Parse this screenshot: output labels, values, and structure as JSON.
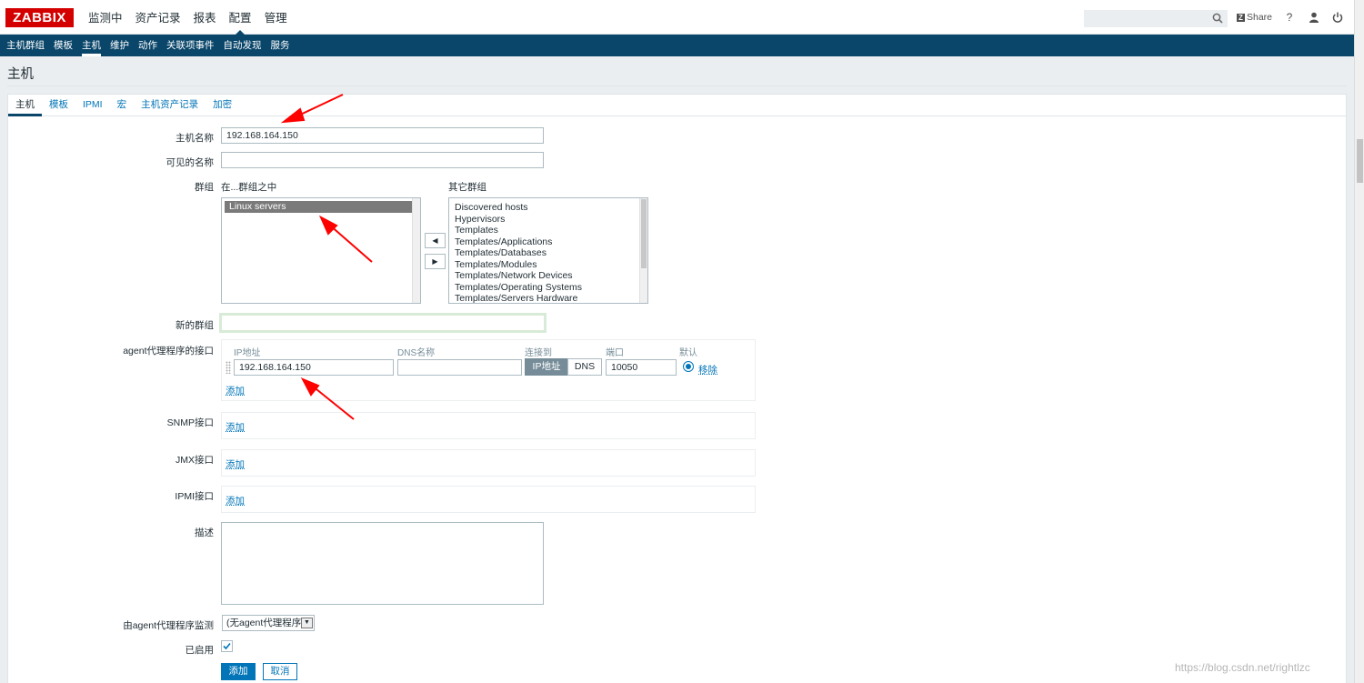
{
  "brand": {
    "logo": "ZABBIX"
  },
  "main_menu": [
    "监测中",
    "资产记录",
    "报表",
    "配置",
    "管理"
  ],
  "active_menu": "配置",
  "header_actions": {
    "share_label": "Share",
    "help": "?",
    "user": "user-icon",
    "logout": "power-icon"
  },
  "sub_nav": [
    "主机群组",
    "模板",
    "主机",
    "维护",
    "动作",
    "关联项事件",
    "自动发现",
    "服务"
  ],
  "page_title": "主机",
  "tabs": [
    "主机",
    "模板",
    "IPMI",
    "宏",
    "主机资产记录",
    "加密"
  ],
  "form": {
    "host_name_label": "主机名称",
    "host_name_value": "192.168.164.150",
    "visible_name_label": "可见的名称",
    "visible_name_value": "",
    "groups_label": "群组",
    "in_groups_label": "在...群组之中",
    "other_groups_label": "其它群组",
    "in_groups": [
      "Linux servers"
    ],
    "other_groups": [
      "Discovered hosts",
      "Hypervisors",
      "Templates",
      "Templates/Applications",
      "Templates/Databases",
      "Templates/Modules",
      "Templates/Network Devices",
      "Templates/Operating Systems",
      "Templates/Servers Hardware"
    ],
    "new_group_label": "新的群组",
    "new_group_value": "",
    "agent_iface_label": "agent代理程序的接口",
    "iface_cols": {
      "ip": "IP地址",
      "dns": "DNS名称",
      "connect": "连接到",
      "port": "端口",
      "default": "默认"
    },
    "agent_ip": "192.168.164.150",
    "agent_dns": "",
    "connect_ip": "IP地址",
    "connect_dns": "DNS",
    "agent_port": "10050",
    "remove_label": "移除",
    "add_label": "添加",
    "snmp_label": "SNMP接口",
    "jmx_label": "JMX接口",
    "ipmi_label": "IPMI接口",
    "description_label": "描述",
    "proxy_label": "由agent代理程序监测",
    "proxy_value": "(无agent代理程序)",
    "enabled_label": "已启用",
    "submit_label": "添加",
    "cancel_label": "取消"
  },
  "watermark": "https://blog.csdn.net/rightlzc",
  "colors": {
    "nav_bg": "#0a466a",
    "link": "#0275b8",
    "brand": "#d40000",
    "annotation": "#ff0000"
  }
}
